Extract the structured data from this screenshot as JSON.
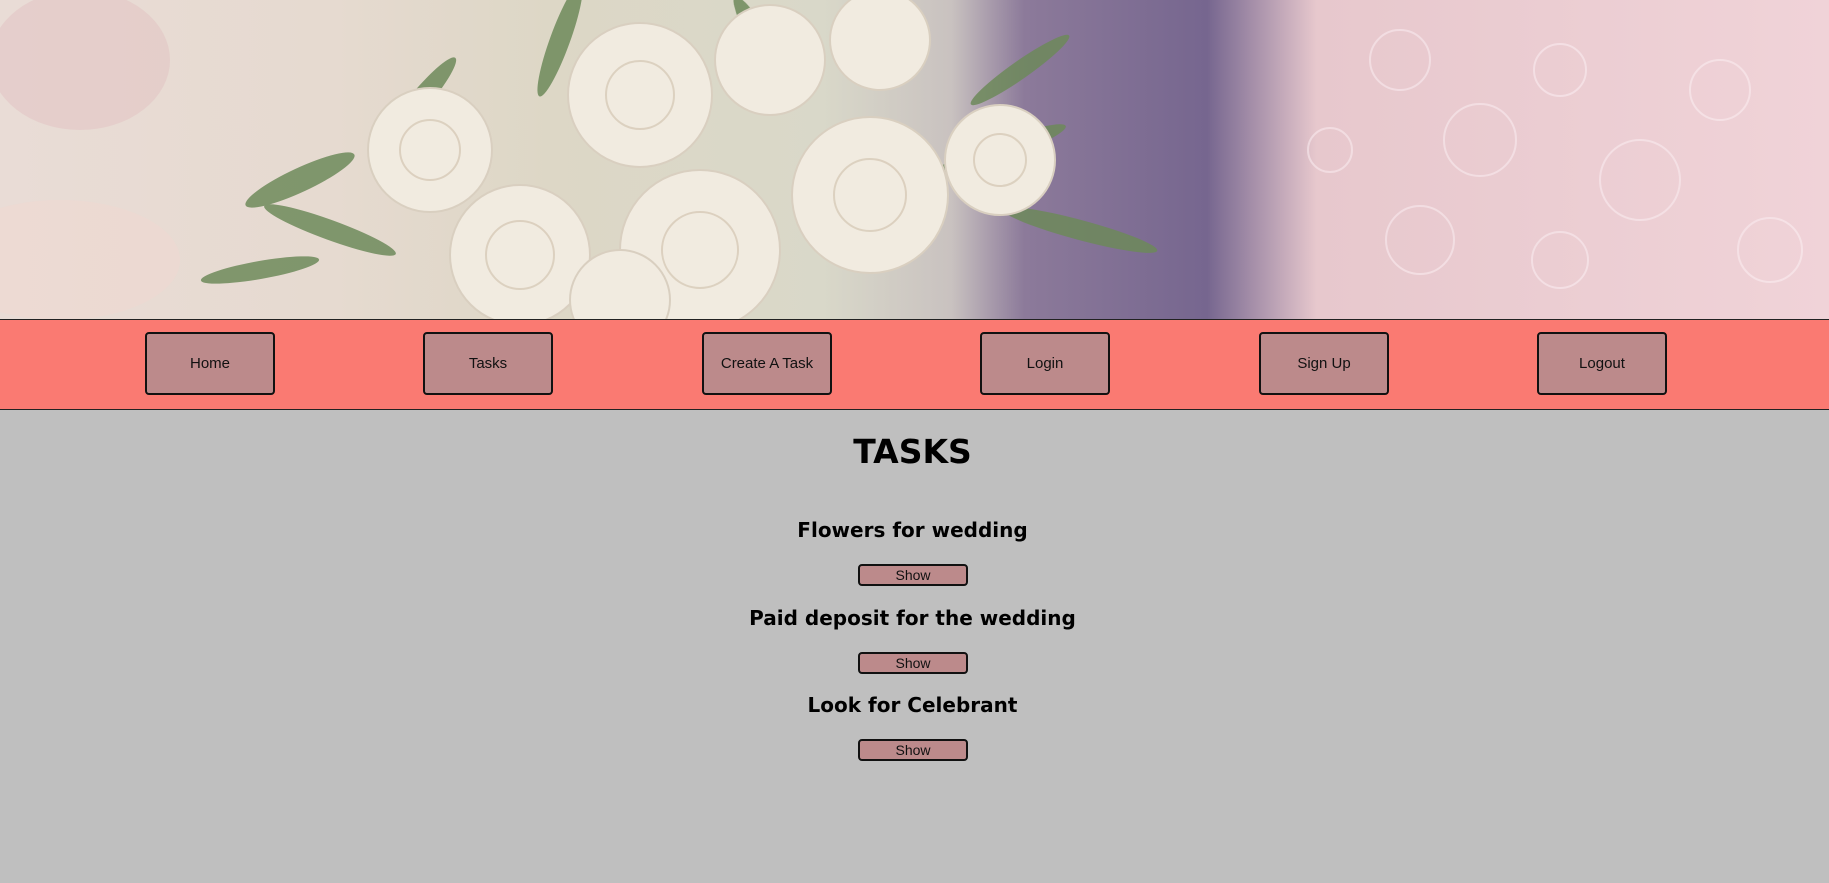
{
  "hero": {
    "image": "wedding-bouquet-photo"
  },
  "nav": {
    "items": [
      {
        "label": "Home"
      },
      {
        "label": "Tasks"
      },
      {
        "label": "Create A Task"
      },
      {
        "label": "Login"
      },
      {
        "label": "Sign Up"
      },
      {
        "label": "Logout"
      }
    ]
  },
  "main": {
    "title": "TASKS",
    "tasks": [
      {
        "title": "Flowers for wedding",
        "button": "Show"
      },
      {
        "title": "Paid deposit for the wedding",
        "button": "Show"
      },
      {
        "title": "Look for Celebrant",
        "button": "Show"
      }
    ]
  },
  "colors": {
    "navbar": "#fa7a72",
    "button": "#bc8a8b",
    "background": "#bfbfbf"
  }
}
